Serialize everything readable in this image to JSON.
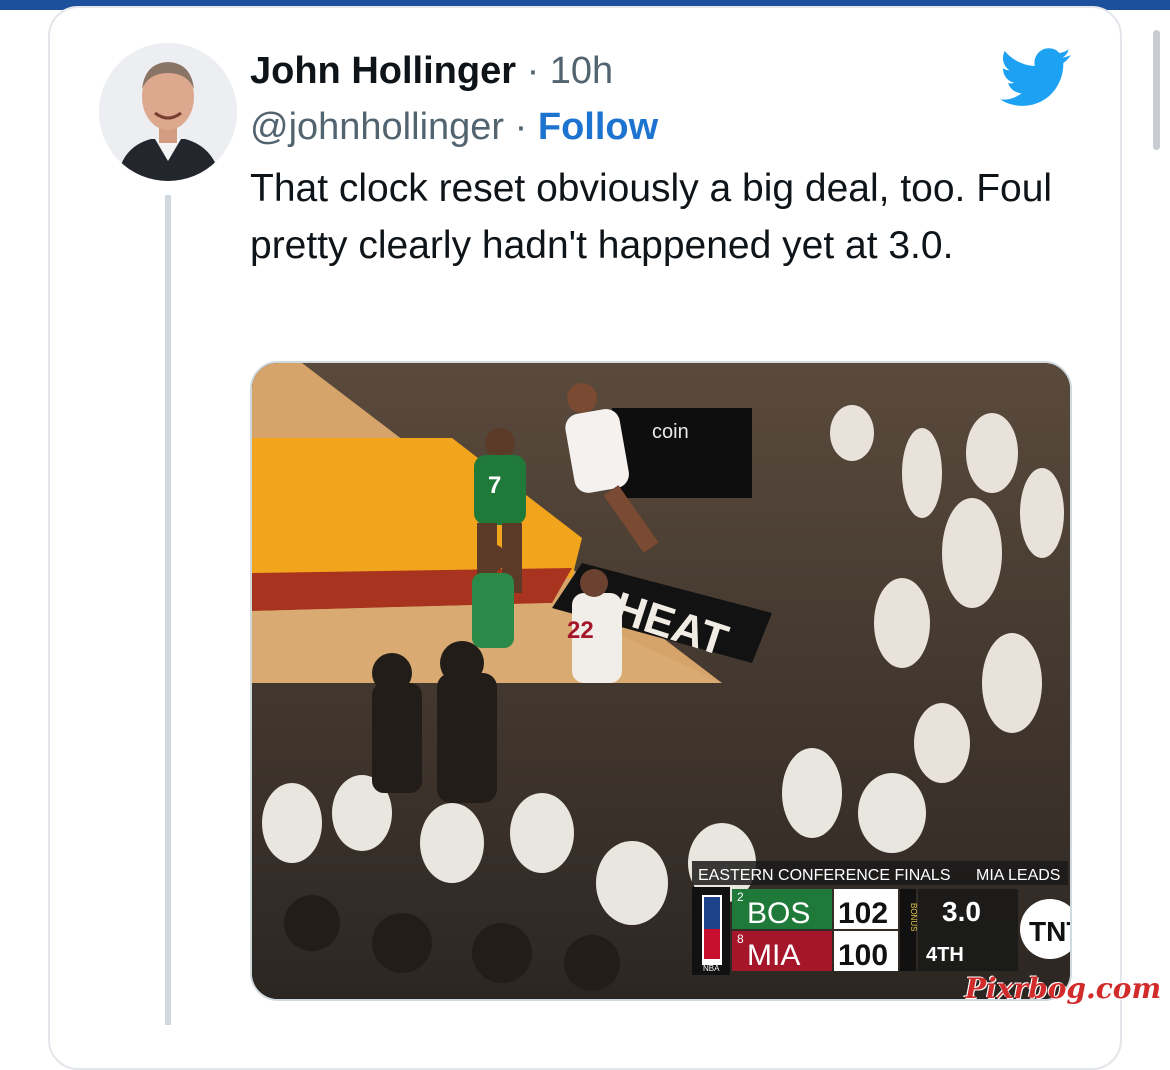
{
  "tweet": {
    "author_name": "John Hollinger",
    "separator": "·",
    "time": "10h",
    "handle": "@johnhollinger",
    "follow_label": "Follow",
    "text": "That clock reset obviously a big deal, too. Foul pretty clearly hadn't happened yet at 3.0."
  },
  "media": {
    "sponsor_text": "coin",
    "jersey_green": "7",
    "jersey_white": "22",
    "court_text": "HEAT",
    "scorebug": {
      "header": "EASTERN CONFERENCE FINALS",
      "series_status": "MIA LEADS",
      "away_seed": "2",
      "away_team": "BOS",
      "away_score": "102",
      "home_seed": "8",
      "home_team": "MIA",
      "home_score": "100",
      "bonus": "BONUS",
      "clock": "3.0",
      "quarter": "4TH",
      "network": "TNT",
      "league": "NBA"
    }
  },
  "watermark": "Pixrbog.com",
  "colors": {
    "top_bar": "#1c4f9c",
    "follow_link": "#1d74d0",
    "twitter_blue": "#1da1f2",
    "celtics_green": "#1f7a3a",
    "heat_red": "#a6162b",
    "court_yellow": "#f2a51c"
  },
  "icons": {
    "brand": "twitter-bird-icon"
  }
}
